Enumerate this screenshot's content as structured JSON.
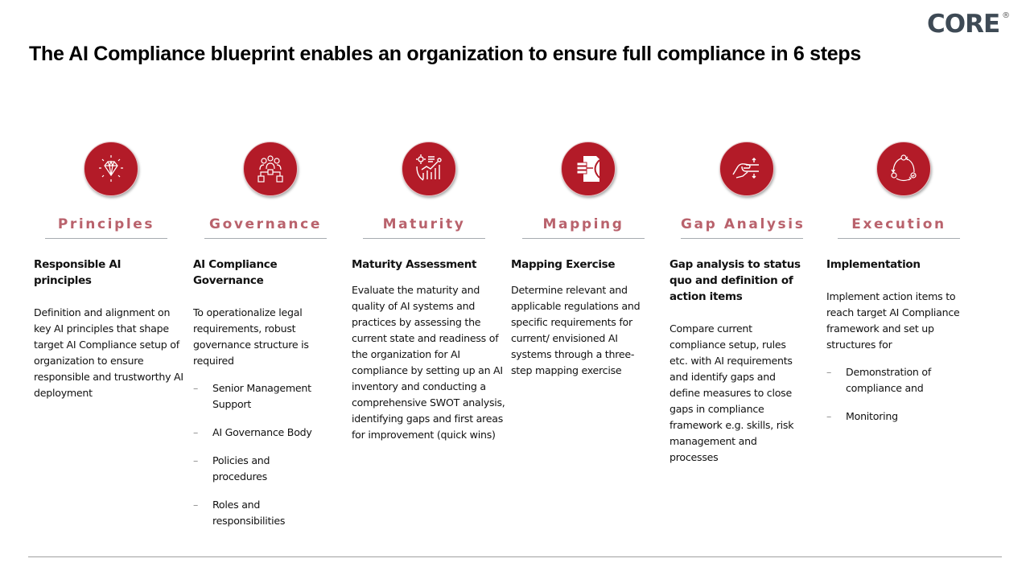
{
  "title": "The AI Compliance blueprint enables an organization to ensure full compliance in 6 steps",
  "logo": {
    "text": "CORE",
    "mark": "®"
  },
  "colors": {
    "accent": "#b31b28",
    "label": "#b9626c",
    "divider": "#a6acb1",
    "logo": "#3e4a55"
  },
  "steps": [
    {
      "icon": "diamond-icon",
      "label": "Principles",
      "heading": "Responsible AI principles",
      "description": "Definition and alignment on key AI principles that shape target AI Compliance setup of organization to ensure responsible and trustworthy AI deployment",
      "bullets": []
    },
    {
      "icon": "org-structure-icon",
      "label": "Governance",
      "heading": "AI Compliance Governance",
      "description": "To operationalize legal requirements, robust governance structure is required",
      "bullets": [
        "Senior Management Support",
        "AI Governance Body",
        "Policies and procedures",
        "Roles and responsibilities"
      ]
    },
    {
      "icon": "analytics-icon",
      "label": "Maturity",
      "heading": "Maturity Assessment",
      "description": "Evaluate the maturity and quality of AI systems and practices by assessing the current state and readiness of the organization for AI compliance by setting up an AI inventory and conducting a comprehensive SWOT analysis, identifying gaps and first areas for improvement (quick wins)",
      "bullets": []
    },
    {
      "icon": "mapping-icon",
      "label": "Mapping",
      "heading": "Mapping Exercise",
      "description": "Determine relevant and applicable regulations and specific requirements for current/ envisioned AI systems through a three-step mapping exercise",
      "bullets": []
    },
    {
      "icon": "hand-gap-icon",
      "label": "Gap Analysis",
      "heading": "Gap analysis to status quo and definition of action items",
      "description": "Compare current compliance setup, rules etc. with AI requirements and identify gaps and define measures to close gaps in compliance framework e.g. skills, risk management and processes",
      "bullets": []
    },
    {
      "icon": "cycle-icon",
      "label": "Execution",
      "heading": "Implementation",
      "description": "Implement action items to reach target AI Compliance framework and set up structures for",
      "bullets": [
        "Demonstration of compliance and",
        "Monitoring"
      ]
    }
  ]
}
